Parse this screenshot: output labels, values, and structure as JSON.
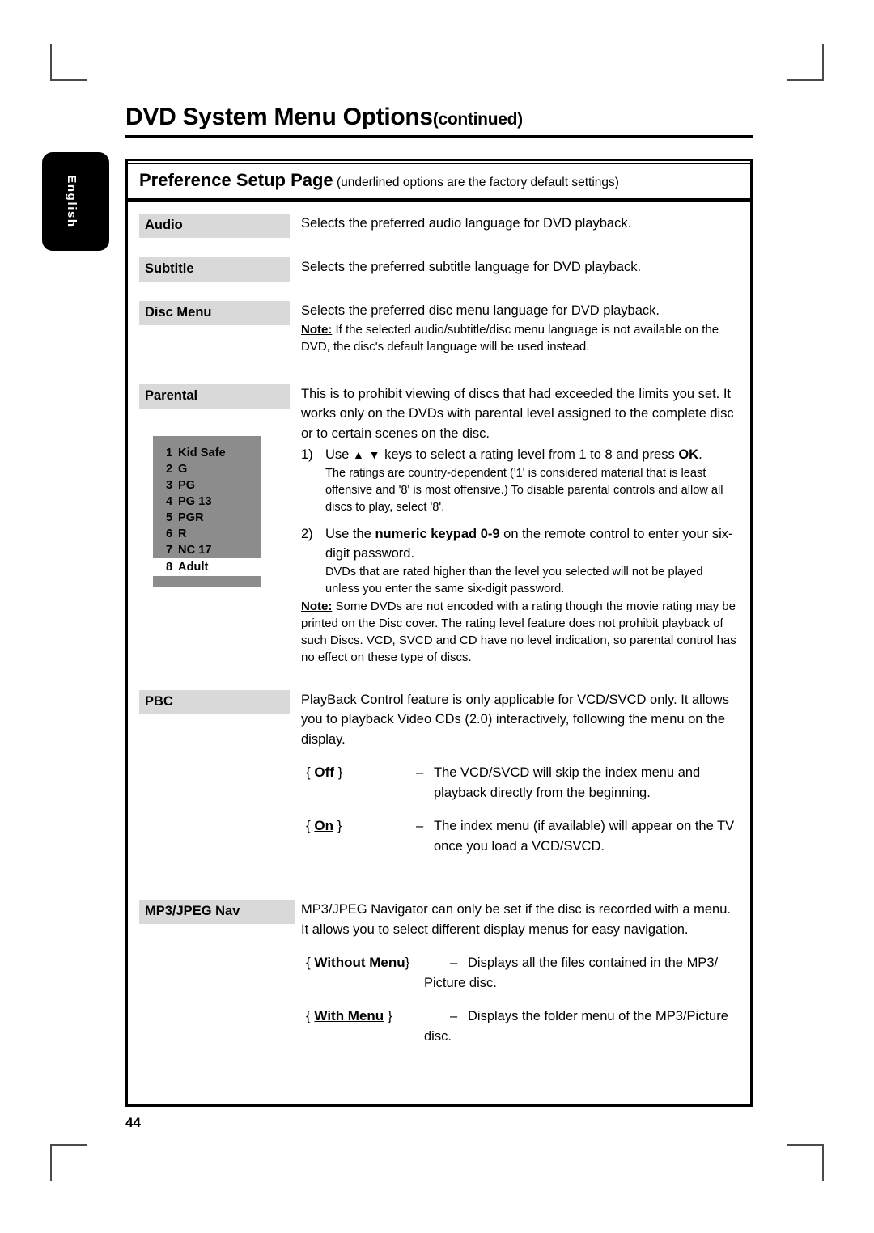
{
  "page": {
    "title_main": "DVD System Menu Options",
    "title_continued": "(continued)",
    "number": "44",
    "language_tab": "English"
  },
  "section": {
    "heading": "Preference Setup Page",
    "heading_note": "(underlined options are the factory default settings)"
  },
  "rows": {
    "audio": {
      "label": "Audio",
      "description": "Selects the preferred audio language for DVD playback."
    },
    "subtitle": {
      "label": "Subtitle",
      "description": "Selects the preferred subtitle language for DVD playback."
    },
    "disc_menu": {
      "label": "Disc Menu",
      "description": "Selects the preferred disc menu language for DVD playback.",
      "note_label": "Note:",
      "note_text": "If the selected audio/subtitle/disc menu language is not available on the DVD, the disc's default language will be used instead."
    },
    "parental": {
      "label": "Parental",
      "description": "This is to prohibit viewing of discs that had exceeded the limits you set.  It works only on the DVDs with parental level assigned to the complete disc or to certain scenes on the disc.",
      "step1": {
        "num": "1)",
        "text_before": "Use",
        "keys": "▲ ▼",
        "text_after": "keys to select a rating level from 1 to 8 and press",
        "emphasis": "OK",
        "emphasis_tail": ".",
        "sub": "The ratings are country-dependent ('1' is considered material that is least offensive and '8' is most offensive.)  To disable parental controls and allow all discs to play, select '8'."
      },
      "step2": {
        "num": "2)",
        "text_before": "Use the",
        "emphasis": "numeric keypad 0-9",
        "text_after": "on the remote control to enter your six-digit password.",
        "sub": "DVDs that are rated higher than the level you selected will not be played unless you enter the same six-digit password."
      },
      "note_label": "Note:",
      "note_text": "Some DVDs are not encoded with a rating though the movie rating may be printed on the Disc cover.  The rating level feature does not prohibit playback of such Discs.  VCD, SVCD and CD have no level indication, so parental control has no effect on these type of discs.",
      "rating_levels": [
        {
          "num": "1",
          "name": "Kid Safe",
          "selected": false
        },
        {
          "num": "2",
          "name": "G",
          "selected": false
        },
        {
          "num": "3",
          "name": "PG",
          "selected": false
        },
        {
          "num": "4",
          "name": "PG 13",
          "selected": false
        },
        {
          "num": "5",
          "name": "PGR",
          "selected": false
        },
        {
          "num": "6",
          "name": "R",
          "selected": false
        },
        {
          "num": "7",
          "name": "NC 17",
          "selected": false
        },
        {
          "num": "8",
          "name": "Adult",
          "selected": true
        }
      ]
    },
    "pbc": {
      "label": "PBC",
      "description": "PlayBack Control feature is only applicable for VCD/SVCD only. It allows you to playback Video CDs (2.0) interactively, following the menu on the display.",
      "options": [
        {
          "key": "Off",
          "key_open": "{",
          "key_close": "}",
          "underlined": false,
          "dash": "–",
          "value": "The VCD/SVCD will skip the index menu and playback directly from the beginning."
        },
        {
          "key": "On",
          "key_open": "{",
          "key_close": "}",
          "underlined": true,
          "dash": "–",
          "value": "The index menu (if available) will appear on the TV once you load a VCD/SVCD."
        }
      ]
    },
    "mp3_jpeg_nav": {
      "label": "MP3/JPEG Nav",
      "description": "MP3/JPEG Navigator can only be set if the disc is recorded with a menu.  It allows you to select different display menus for easy navigation.",
      "options": [
        {
          "key": "Without Menu",
          "key_open": "{",
          "key_close": "}",
          "underlined": false,
          "dash": "–",
          "value": "Displays all the files contained in the MP3/",
          "value_cont": "Picture disc."
        },
        {
          "key": "With Menu",
          "key_open": "{",
          "key_close": "}",
          "underlined": true,
          "dash": "–",
          "value": "Displays the folder menu of the MP3/Picture",
          "value_cont": "disc."
        }
      ]
    }
  }
}
